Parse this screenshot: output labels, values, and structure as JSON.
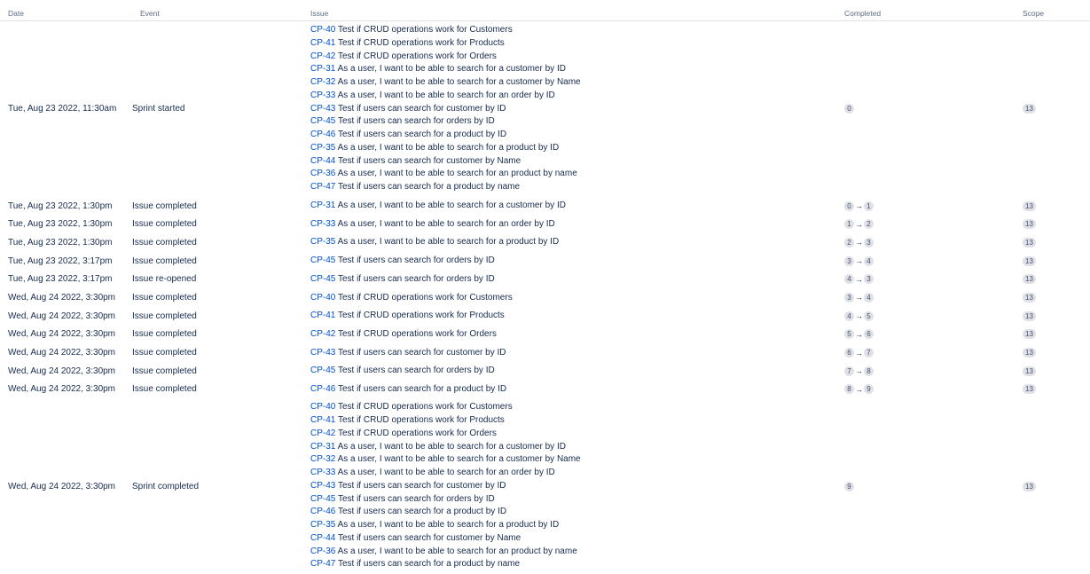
{
  "headers": {
    "date": "Date",
    "event": "Event",
    "issue": "Issue",
    "completed": "Completed",
    "scope": "Scope"
  },
  "rows": [
    {
      "date": "Tue, Aug 23 2022, 11:30am",
      "event": "Sprint started",
      "issues": [
        {
          "key": "CP-40",
          "summary": "Test if CRUD operations work for Customers"
        },
        {
          "key": "CP-41",
          "summary": "Test if CRUD operations work for Products"
        },
        {
          "key": "CP-42",
          "summary": "Test if CRUD operations work for Orders"
        },
        {
          "key": "CP-31",
          "summary": "As a user, I want to be able to search for a customer by ID"
        },
        {
          "key": "CP-32",
          "summary": "As a user, I want to be able to search for a customer by Name"
        },
        {
          "key": "CP-33",
          "summary": "As a user, I want to be able to search for an order by ID"
        },
        {
          "key": "CP-43",
          "summary": "Test if users can search for customer by ID"
        },
        {
          "key": "CP-45",
          "summary": "Test if users can search for orders by ID"
        },
        {
          "key": "CP-46",
          "summary": "Test if users can search for a product by ID"
        },
        {
          "key": "CP-35",
          "summary": "As a user, I want to be able to search for a product by ID"
        },
        {
          "key": "CP-44",
          "summary": "Test if users can search for customer by Name"
        },
        {
          "key": "CP-36",
          "summary": "As a user, I want to be able to search for an product by name"
        },
        {
          "key": "CP-47",
          "summary": "Test if users can search for a product by name"
        }
      ],
      "completed_from": null,
      "completed_to": "0",
      "scope": "13"
    },
    {
      "date": "Tue, Aug 23 2022, 1:30pm",
      "event": "Issue completed",
      "issues": [
        {
          "key": "CP-31",
          "summary": "As a user, I want to be able to search for a customer by ID"
        }
      ],
      "completed_from": "0",
      "completed_to": "1",
      "scope": "13"
    },
    {
      "date": "Tue, Aug 23 2022, 1:30pm",
      "event": "Issue completed",
      "issues": [
        {
          "key": "CP-33",
          "summary": "As a user, I want to be able to search for an order by ID"
        }
      ],
      "completed_from": "1",
      "completed_to": "2",
      "scope": "13"
    },
    {
      "date": "Tue, Aug 23 2022, 1:30pm",
      "event": "Issue completed",
      "issues": [
        {
          "key": "CP-35",
          "summary": "As a user, I want to be able to search for a product by ID"
        }
      ],
      "completed_from": "2",
      "completed_to": "3",
      "scope": "13"
    },
    {
      "date": "Tue, Aug 23 2022, 3:17pm",
      "event": "Issue completed",
      "issues": [
        {
          "key": "CP-45",
          "summary": "Test if users can search for orders by ID"
        }
      ],
      "completed_from": "3",
      "completed_to": "4",
      "scope": "13"
    },
    {
      "date": "Tue, Aug 23 2022, 3:17pm",
      "event": "Issue re-opened",
      "issues": [
        {
          "key": "CP-45",
          "summary": "Test if users can search for orders by ID"
        }
      ],
      "completed_from": "4",
      "completed_to": "3",
      "scope": "13"
    },
    {
      "date": "Wed, Aug 24 2022, 3:30pm",
      "event": "Issue completed",
      "issues": [
        {
          "key": "CP-40",
          "summary": "Test if CRUD operations work for Customers"
        }
      ],
      "completed_from": "3",
      "completed_to": "4",
      "scope": "13"
    },
    {
      "date": "Wed, Aug 24 2022, 3:30pm",
      "event": "Issue completed",
      "issues": [
        {
          "key": "CP-41",
          "summary": "Test if CRUD operations work for Products"
        }
      ],
      "completed_from": "4",
      "completed_to": "5",
      "scope": "13"
    },
    {
      "date": "Wed, Aug 24 2022, 3:30pm",
      "event": "Issue completed",
      "issues": [
        {
          "key": "CP-42",
          "summary": "Test if CRUD operations work for Orders"
        }
      ],
      "completed_from": "5",
      "completed_to": "6",
      "scope": "13"
    },
    {
      "date": "Wed, Aug 24 2022, 3:30pm",
      "event": "Issue completed",
      "issues": [
        {
          "key": "CP-43",
          "summary": "Test if users can search for customer by ID"
        }
      ],
      "completed_from": "6",
      "completed_to": "7",
      "scope": "13"
    },
    {
      "date": "Wed, Aug 24 2022, 3:30pm",
      "event": "Issue completed",
      "issues": [
        {
          "key": "CP-45",
          "summary": "Test if users can search for orders by ID"
        }
      ],
      "completed_from": "7",
      "completed_to": "8",
      "scope": "13"
    },
    {
      "date": "Wed, Aug 24 2022, 3:30pm",
      "event": "Issue completed",
      "issues": [
        {
          "key": "CP-46",
          "summary": "Test if users can search for a product by ID"
        }
      ],
      "completed_from": "8",
      "completed_to": "9",
      "scope": "13"
    },
    {
      "date": "Wed, Aug 24 2022, 3:30pm",
      "event": "Sprint completed",
      "issues": [
        {
          "key": "CP-40",
          "summary": "Test if CRUD operations work for Customers"
        },
        {
          "key": "CP-41",
          "summary": "Test if CRUD operations work for Products"
        },
        {
          "key": "CP-42",
          "summary": "Test if CRUD operations work for Orders"
        },
        {
          "key": "CP-31",
          "summary": "As a user, I want to be able to search for a customer by ID"
        },
        {
          "key": "CP-32",
          "summary": "As a user, I want to be able to search for a customer by Name"
        },
        {
          "key": "CP-33",
          "summary": "As a user, I want to be able to search for an order by ID"
        },
        {
          "key": "CP-43",
          "summary": "Test if users can search for customer by ID"
        },
        {
          "key": "CP-45",
          "summary": "Test if users can search for orders by ID"
        },
        {
          "key": "CP-46",
          "summary": "Test if users can search for a product by ID"
        },
        {
          "key": "CP-35",
          "summary": "As a user, I want to be able to search for a product by ID"
        },
        {
          "key": "CP-44",
          "summary": "Test if users can search for customer by Name"
        },
        {
          "key": "CP-36",
          "summary": "As a user, I want to be able to search for an product by name"
        },
        {
          "key": "CP-47",
          "summary": "Test if users can search for a product by name"
        }
      ],
      "completed_from": null,
      "completed_to": "9",
      "scope": "13"
    }
  ],
  "colors": {
    "link": "#0052cc",
    "text": "#172b4d",
    "header_text": "#5e6c84",
    "lozenge_bg": "#dfe1e6"
  },
  "icons": {
    "arrow": "→"
  }
}
